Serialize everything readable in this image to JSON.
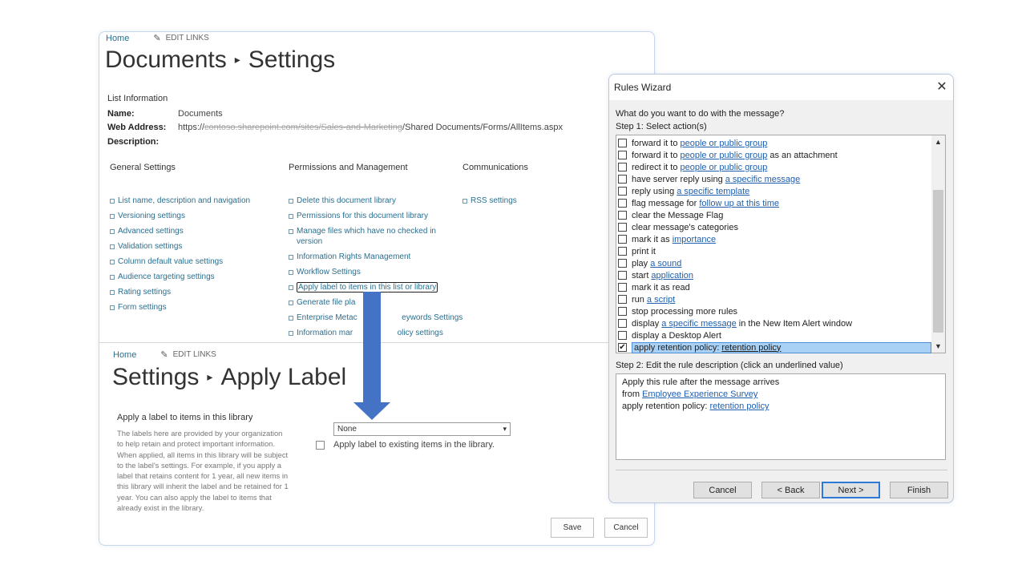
{
  "sp_top": {
    "home": "Home",
    "edit_links": "EDIT LINKS",
    "title_left": "Documents",
    "title_sep": "▸",
    "title_right": "Settings",
    "list_info_heading": "List Information",
    "name_label": "Name:",
    "name_value": "Documents",
    "web_address_label": "Web Address:",
    "web_address_prefix": "https://",
    "web_address_blurred": "​contoso.sharepoint.com/sites/Sales-and-Marketing",
    "web_address_suffix": "/Shared Documents/Forms/AllItems.aspx",
    "description_label": "Description:",
    "general_settings": {
      "heading": "General Settings",
      "links": [
        "List name, description and navigation",
        "Versioning settings",
        "Advanced settings",
        "Validation settings",
        "Column default value settings",
        "Audience targeting settings",
        "Rating settings",
        "Form settings"
      ]
    },
    "permissions": {
      "heading": "Permissions and Management",
      "links": [
        "Delete this document library",
        "Permissions for this document library",
        "Manage files which have no checked in version",
        "Information Rights Management",
        "Workflow Settings",
        "Apply label to items in this list or library",
        "Generate file pla",
        "Enterprise Metac                    eywords Settings",
        "Information mar                    olicy settings"
      ]
    },
    "communications": {
      "heading": "Communications",
      "links": [
        "RSS settings"
      ]
    }
  },
  "sp_bottom": {
    "home": "Home",
    "edit_links": "EDIT LINKS",
    "title_left": "Settings",
    "title_sep": "▸",
    "title_right": "Apply Label",
    "section_heading": "Apply a label to items in this library",
    "section_desc": "The labels here are provided by your organization to help retain and protect important information. When applied, all items in this library will be subject to the label's settings. For example, if you apply a label that retains content for 1 year, all new items in this library will inherit the label and be retained for 1 year. You can also apply the label to items that already exist in the library.",
    "select_value": "None",
    "checkbox_label": "Apply label to existing items in the library.",
    "save": "Save",
    "cancel": "Cancel"
  },
  "rules_wizard": {
    "title": "Rules Wizard",
    "question": "What do you want to do with the message?",
    "step1": "Step 1: Select action(s)",
    "actions": [
      {
        "pre": "forward it to",
        "link": "people or public group",
        "post": "",
        "checked": false
      },
      {
        "pre": "forward it to",
        "link": "people or public group",
        "post": "as an attachment",
        "checked": false
      },
      {
        "pre": "redirect it to",
        "link": "people or public group",
        "post": "",
        "checked": false
      },
      {
        "pre": "have server reply using",
        "link": "a specific message",
        "post": "",
        "checked": false
      },
      {
        "pre": "reply using",
        "link": "a specific template",
        "post": "",
        "checked": false
      },
      {
        "pre": "flag message for",
        "link": "follow up at this time",
        "post": "",
        "checked": false
      },
      {
        "pre": "clear the Message Flag",
        "link": "",
        "post": "",
        "checked": false
      },
      {
        "pre": "clear message's categories",
        "link": "",
        "post": "",
        "checked": false
      },
      {
        "pre": "mark it as",
        "link": "importance",
        "post": "",
        "checked": false
      },
      {
        "pre": "print it",
        "link": "",
        "post": "",
        "checked": false
      },
      {
        "pre": "play",
        "link": "a sound",
        "post": "",
        "checked": false
      },
      {
        "pre": "start",
        "link": "application",
        "post": "",
        "checked": false
      },
      {
        "pre": "mark it as read",
        "link": "",
        "post": "",
        "checked": false
      },
      {
        "pre": "run",
        "link": "a script",
        "post": "",
        "checked": false
      },
      {
        "pre": "stop processing more rules",
        "link": "",
        "post": "",
        "checked": false
      },
      {
        "pre": "display",
        "link": "a specific message",
        "post": "in the New Item Alert window",
        "checked": false
      },
      {
        "pre": "display a Desktop Alert",
        "link": "",
        "post": "",
        "checked": false
      },
      {
        "pre": "apply retention policy:",
        "link": "retention policy",
        "post": "",
        "checked": true
      }
    ],
    "step2": "Step 2: Edit the rule description (click an underlined value)",
    "desc_line1": "Apply this rule after the message arrives",
    "desc_line2_pre": "from",
    "desc_line2_link": "Employee Experience Survey",
    "desc_line3_pre": "apply retention policy:",
    "desc_line3_link": "retention policy",
    "buttons": {
      "cancel": "Cancel",
      "back": "< Back",
      "next": "Next >",
      "finish": "Finish"
    }
  },
  "colors": {
    "link": "#2a6f8f",
    "outlook_link": "#1f5fad",
    "arrow": "#4472c4",
    "selection": "#a9d1f5"
  }
}
